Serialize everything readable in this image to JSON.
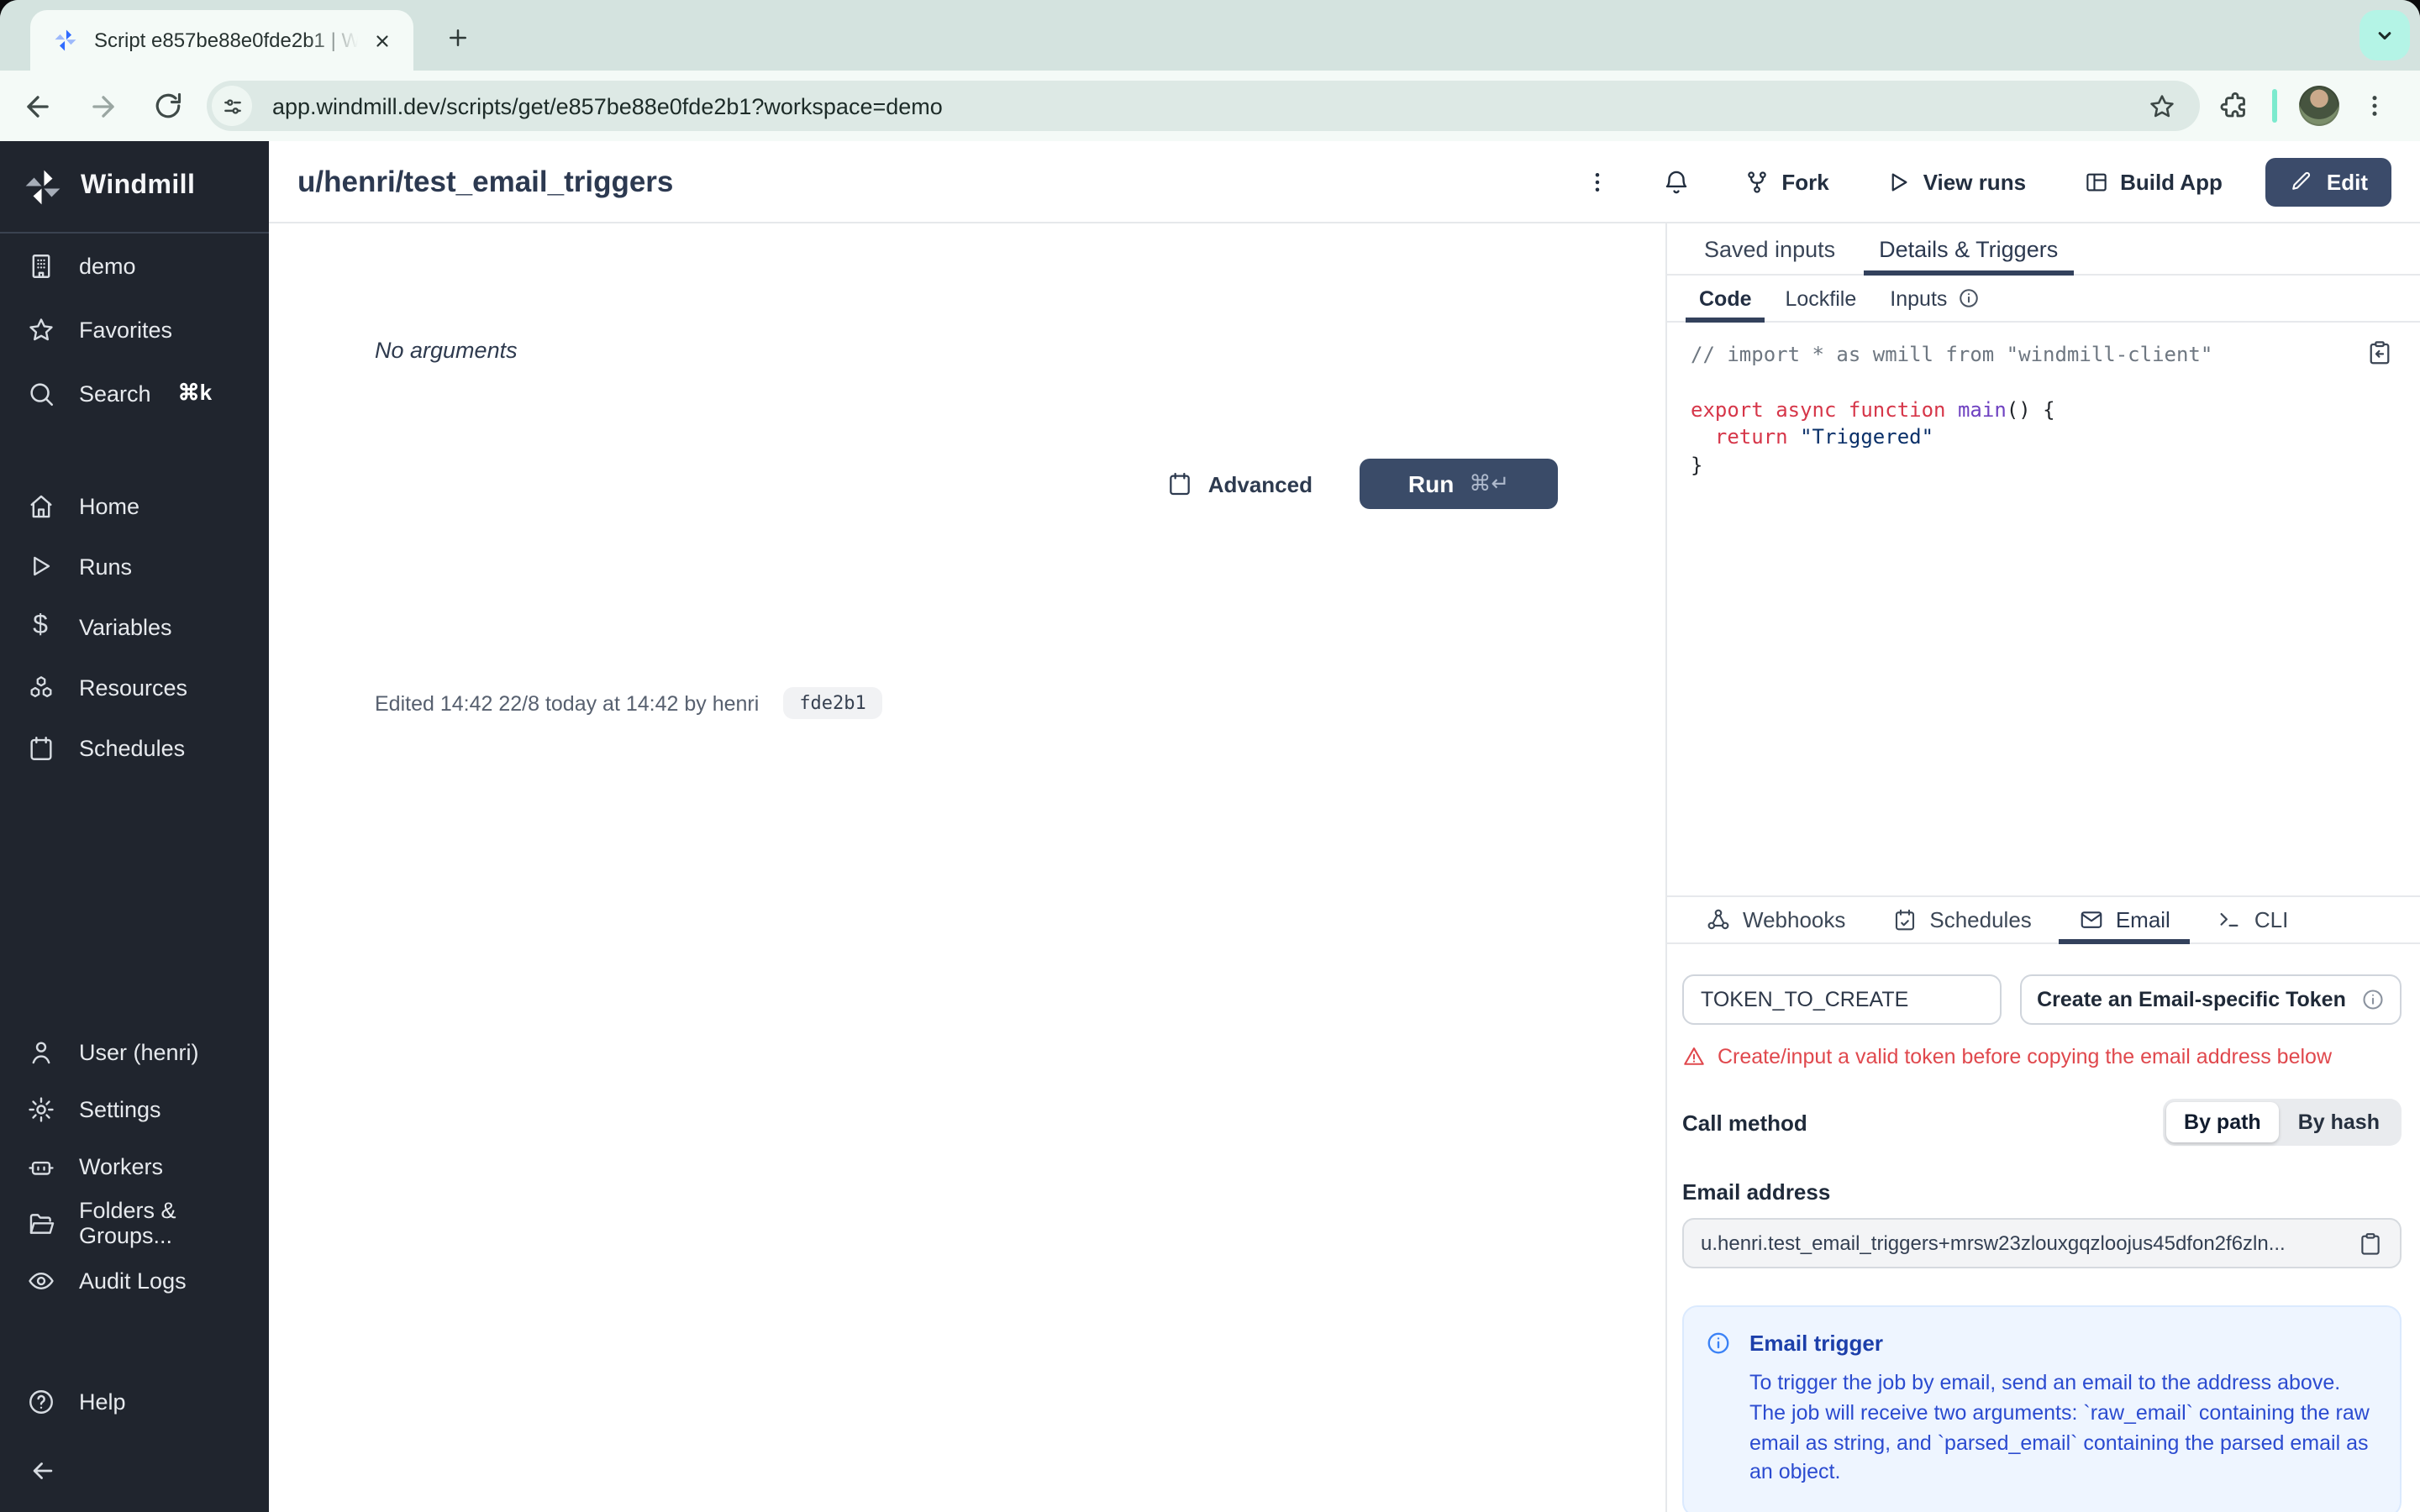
{
  "browser": {
    "tab_title": "Script e857be88e0fde2b1 | W",
    "url": "app.windmill.dev/scripts/get/e857be88e0fde2b1?workspace=demo",
    "new_tab_glyph": "+",
    "close_glyph": "×"
  },
  "sidebar": {
    "brand": "Windmill",
    "group1": [
      "demo",
      "Favorites",
      "Search"
    ],
    "search_shortcut": "⌘k",
    "group2": [
      "Home",
      "Runs",
      "Variables",
      "Resources",
      "Schedules"
    ],
    "group3": [
      "User (henri)",
      "Settings",
      "Workers",
      "Folders & Groups...",
      "Audit Logs"
    ],
    "help_label": "Help"
  },
  "header": {
    "title": "u/henri/test_email_triggers",
    "fork_label": "Fork",
    "view_runs_label": "View runs",
    "build_app_label": "Build App",
    "edit_label": "Edit"
  },
  "main": {
    "no_arguments": "No arguments",
    "advanced_label": "Advanced",
    "run_label": "Run",
    "run_shortcut": "⌘↵",
    "edited_text": "Edited 14:42 22/8 today at 14:42 by henri",
    "hash_badge": "fde2b1"
  },
  "details_panel": {
    "tabs": [
      "Saved inputs",
      "Details & Triggers"
    ],
    "subtabs": [
      "Code",
      "Lockfile",
      "Inputs"
    ],
    "code_lines": [
      [
        {
          "t": "// import * as wmill from \"windmill-client\"",
          "c": "com"
        }
      ],
      [],
      [
        {
          "t": "export",
          "c": "kw"
        },
        {
          "t": " ",
          "c": "plain"
        },
        {
          "t": "async",
          "c": "kw"
        },
        {
          "t": " ",
          "c": "plain"
        },
        {
          "t": "function",
          "c": "kw"
        },
        {
          "t": " ",
          "c": "plain"
        },
        {
          "t": "main",
          "c": "fn"
        },
        {
          "t": "() {",
          "c": "plain"
        }
      ],
      [
        {
          "t": "  ",
          "c": "plain"
        },
        {
          "t": "return",
          "c": "kw"
        },
        {
          "t": " ",
          "c": "plain"
        },
        {
          "t": "\"Triggered\"",
          "c": "str"
        }
      ],
      [
        {
          "t": "}",
          "c": "plain"
        }
      ]
    ],
    "trigger_tabs": [
      "Webhooks",
      "Schedules",
      "Email",
      "CLI"
    ],
    "email": {
      "token_value": "TOKEN_TO_CREATE",
      "create_token_label": "Create an Email-specific Token",
      "warning": "Create/input a valid token before copying the email address below",
      "call_method_label": "Call method",
      "by_path_label": "By path",
      "by_hash_label": "By hash",
      "email_address_label": "Email address",
      "email_address": "u.henri.test_email_triggers+mrsw23zlouxgqzloojus45dfon2f6zln...",
      "info_title": "Email trigger",
      "info_body": "To trigger the job by email, send an email to the address above. The job will receive two arguments: `raw_email` containing the raw email as string, and `parsed_email` containing the parsed email as an object."
    }
  },
  "colors": {
    "chrome_strip": "#d4e3df",
    "chrome_toolbar": "#f4faf7",
    "url_pill": "#dde9e5",
    "mint_chip": "#b4f4e6",
    "sidebar_bg": "#20252e",
    "navy_button": "#3a4b68",
    "tab_underline": "#33415c",
    "warning_red": "#e0484d",
    "info_blue_bg": "#eef5ff",
    "info_blue_text": "#2b4bd0",
    "code_keyword": "#d63649",
    "code_function": "#6f42c1",
    "code_string": "#0a3069",
    "code_comment": "#6e7781"
  }
}
